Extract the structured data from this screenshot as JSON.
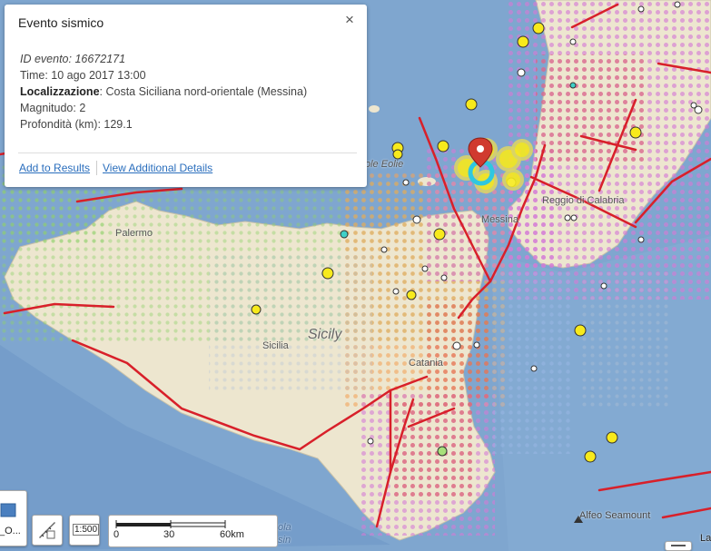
{
  "popup": {
    "title": "Evento sismico",
    "close_symbol": "×",
    "event_id": "ID evento: 16672171",
    "time": "Time: 10 ago 2017 13:00",
    "location_label": "Localizzazione",
    "location_value": ": Costa Siciliana nord-orientale (Messina)",
    "magnitude": "Magnitudo: 2",
    "depth": "Profondità (km): 129.1",
    "add_link": "Add to Results",
    "details_link": "View Additional Details"
  },
  "map_labels": {
    "eolie": "ole Eolie",
    "palermo": "Palermo",
    "messina": "Messina",
    "reggio": "Reggio di Calabria",
    "sicily": "Sicily",
    "sicilia": "Sicilia",
    "catania": "Catania",
    "alfeo": "Alfeo Seamount",
    "cut_bottom1": "ola",
    "cut_bottom2": "sin",
    "corner_cut": "La"
  },
  "toolbar": {
    "layer_label": "_O...",
    "scale_button": "1:500"
  },
  "scalebar": {
    "labels": [
      "0",
      "30",
      "60km"
    ]
  },
  "colors": {
    "land": "#ede6cf",
    "sea": "#7fa6cf",
    "fault": "#d8202a",
    "quake_yellow": "#f7ea1c",
    "highlight": "#2fc7e0",
    "marker_red": "#d03a2f"
  },
  "icons": [
    "close-icon",
    "map-pin-icon",
    "layer-icon",
    "measure-icon",
    "seamount-triangle-icon"
  ]
}
